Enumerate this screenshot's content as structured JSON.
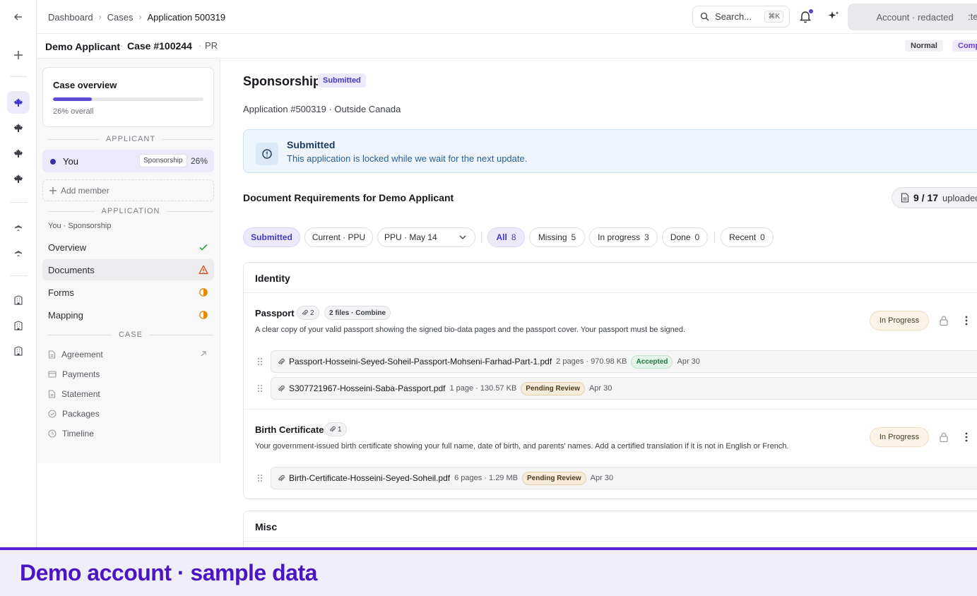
{
  "topbar": {
    "breadcrumbs": [
      "Dashboard",
      "Cases",
      "Application 500319"
    ],
    "search_placeholder": "Search...",
    "search_shortcut": "⌘K",
    "account_label": "Account · redacted",
    "account_trail": ":te"
  },
  "casebar": {
    "applicant": "Demo Applicant",
    "case_number": "Case #100244",
    "program": "PR",
    "priority": "Normal",
    "status_clip": "Comp"
  },
  "sidebar": {
    "overview_title": "Case overview",
    "overview_progress": 0.26,
    "overview_pct": "26% overall",
    "applicant_header": "APPLICANT",
    "applicant": {
      "name": "You",
      "tag": "Sponsorship",
      "pct": "26%"
    },
    "add_member": "Add member",
    "application_header": "APPLICATION",
    "application_sub": "You · Sponsorship",
    "nav": [
      {
        "label": "Overview",
        "status": "check"
      },
      {
        "label": "Documents",
        "status": "warning"
      },
      {
        "label": "Forms",
        "status": "half"
      },
      {
        "label": "Mapping",
        "status": "half"
      }
    ],
    "case_header": "CASE",
    "case_nav": [
      {
        "label": "Agreement",
        "icon": "file-icon"
      },
      {
        "label": "Payments",
        "icon": "card-icon"
      },
      {
        "label": "Statement",
        "icon": "file-icon"
      },
      {
        "label": "Packages",
        "icon": "check-circle-icon"
      },
      {
        "label": "Timeline",
        "icon": "clock-icon"
      }
    ]
  },
  "main": {
    "title": "Sponsorship",
    "title_badge": "Submitted",
    "subtitle": "Application #500319 · Outside Canada",
    "notice": {
      "title": "Submitted",
      "text": "This application is locked while we wait for the next update."
    },
    "requirements_title": "Document Requirements for Demo Applicant",
    "uploaded_count": "9 / 17",
    "uploaded_label": "uploaded",
    "filters": {
      "submitted": "Submitted",
      "current": "Current · PPU",
      "select_value": "PPU · May 14",
      "all": {
        "label": "All",
        "count": "8"
      },
      "missing": {
        "label": "Missing",
        "count": "5"
      },
      "in_progress": {
        "label": "In progress",
        "count": "3"
      },
      "done": {
        "label": "Done",
        "count": "0"
      },
      "recent": {
        "label": "Recent",
        "count": "0"
      }
    },
    "sections": [
      {
        "title": "Identity",
        "documents": [
          {
            "title": "Passport",
            "count": "2",
            "combine": "2 files · Combine",
            "description": "A clear copy of your valid passport showing the signed bio-data pages and the passport cover. Your passport must be signed.",
            "status": "In Progress",
            "files": [
              {
                "name": "Passport-Hosseini-Seyed-Soheil-Passport-Mohseni-Farhad-Part-1.pdf",
                "meta": "2 pages · 970.98 KB",
                "status": "Accepted",
                "date": "Apr 30"
              },
              {
                "name": "S307721967-Hosseini-Saba-Passport.pdf",
                "meta": "1 page · 130.57 KB",
                "status": "Pending Review",
                "date": "Apr 30"
              }
            ]
          },
          {
            "title": "Birth Certificate",
            "count": "1",
            "description": "Your government-issued birth certificate showing your full name, date of birth, and parents' names. Add a certified translation if it is not in English or French.",
            "status": "In Progress",
            "files": [
              {
                "name": "Birth-Certificate-Hosseini-Seyed-Soheil.pdf",
                "meta": "6 pages · 1.29 MB",
                "status": "Pending Review",
                "date": "Apr 30"
              }
            ]
          }
        ]
      },
      {
        "title": "Misc"
      }
    ]
  },
  "banner": "Demo account · sample data",
  "colors": {
    "accent": "#4338ca",
    "banner": "#4a16c4",
    "warning": "#d9480f",
    "success": "#2f9e44",
    "half": "#e8890c"
  }
}
